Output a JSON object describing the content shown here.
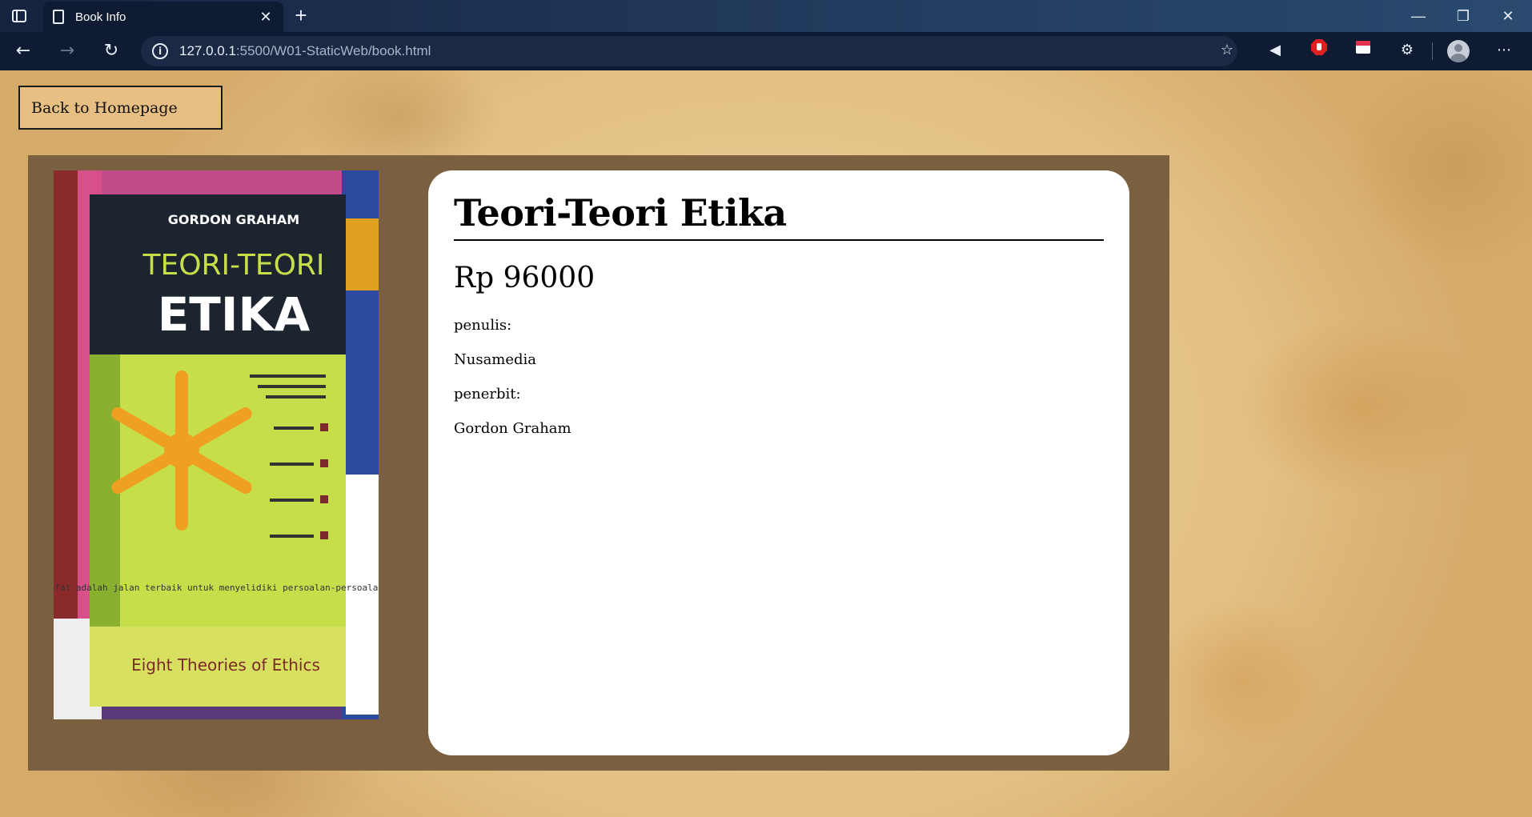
{
  "browser": {
    "tab_title": "Book Info",
    "url_host": "127.0.0.1",
    "url_path": ":5500/W01-StaticWeb/book.html"
  },
  "page": {
    "back_button": "Back to Homepage",
    "book": {
      "title": "Teori-Teori Etika",
      "price": "Rp 96000",
      "author_label": "penulis:",
      "author_value": "Nusamedia",
      "publisher_label": "penerbit:",
      "publisher_value": "Gordon Graham"
    },
    "cover": {
      "author": "GORDON GRAHAM",
      "title_line1": "TEORI-TEORI",
      "title_line2": "ETIKA",
      "quote": "Filsafat adalah jalan terbaik untuk menyelidiki persoalan-persoalan etika",
      "subtitle": "Eight Theories of Ethics"
    }
  }
}
